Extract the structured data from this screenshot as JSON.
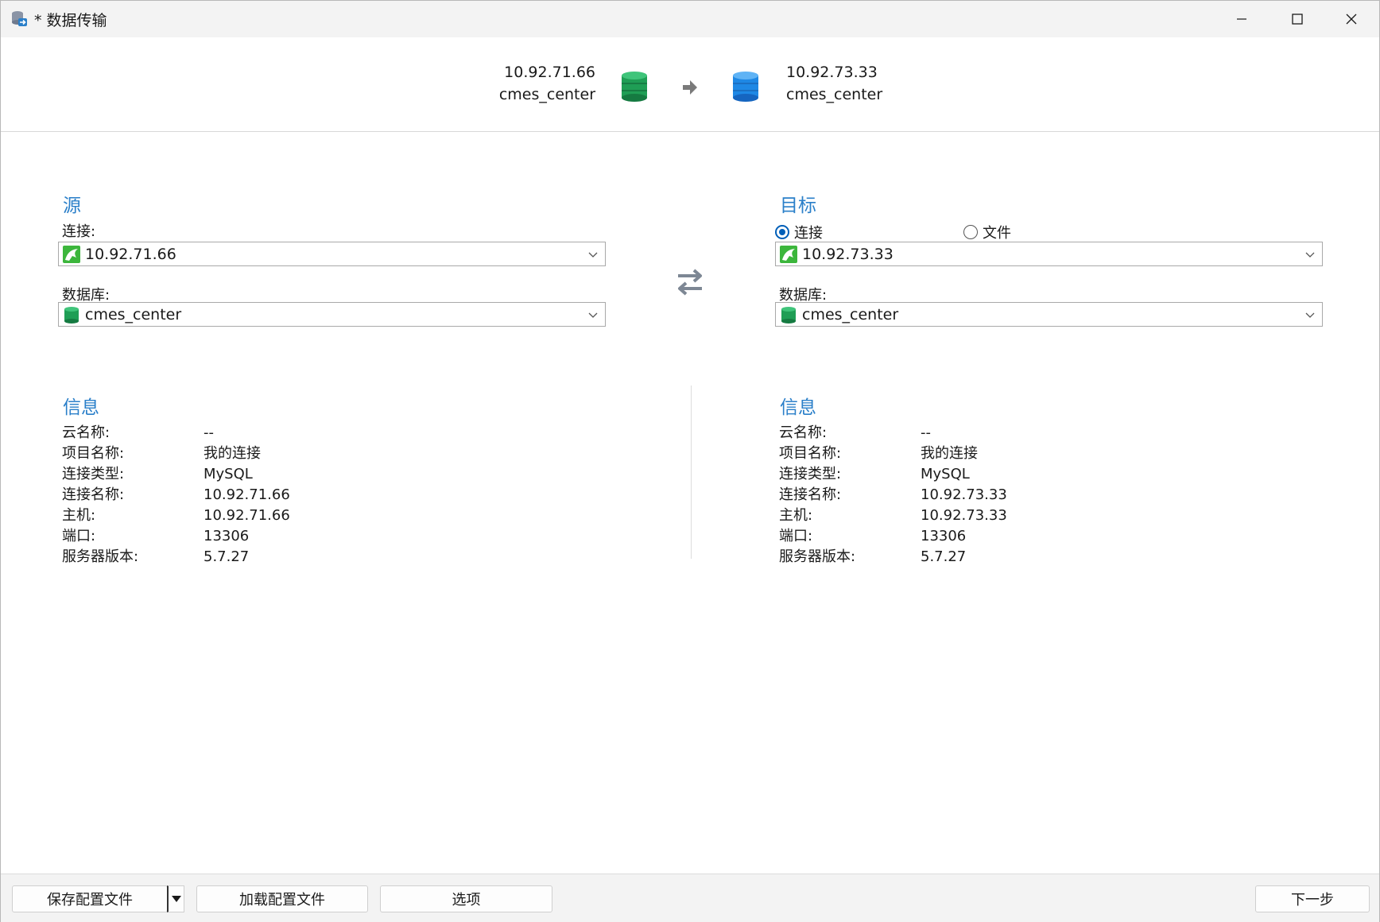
{
  "window": {
    "title": "* 数据传输"
  },
  "header": {
    "source_host": "10.92.71.66",
    "source_db": "cmes_center",
    "target_host": "10.92.73.33",
    "target_db": "cmes_center"
  },
  "source": {
    "title": "源",
    "connection_label": "连接:",
    "connection_value": "10.92.71.66",
    "database_label": "数据库:",
    "database_value": "cmes_center"
  },
  "target": {
    "title": "目标",
    "radio_connection": "连接",
    "radio_file": "文件",
    "connection_value": "10.92.73.33",
    "database_label": "数据库:",
    "database_value": "cmes_center"
  },
  "source_info": {
    "title": "信息",
    "rows": [
      {
        "key": "云名称:",
        "value": "--"
      },
      {
        "key": "项目名称:",
        "value": "我的连接"
      },
      {
        "key": "连接类型:",
        "value": "MySQL"
      },
      {
        "key": "连接名称:",
        "value": "10.92.71.66"
      },
      {
        "key": "主机:",
        "value": "10.92.71.66"
      },
      {
        "key": "端口:",
        "value": "13306"
      },
      {
        "key": "服务器版本:",
        "value": "5.7.27"
      }
    ]
  },
  "target_info": {
    "title": "信息",
    "rows": [
      {
        "key": "云名称:",
        "value": "--"
      },
      {
        "key": "项目名称:",
        "value": "我的连接"
      },
      {
        "key": "连接类型:",
        "value": "MySQL"
      },
      {
        "key": "连接名称:",
        "value": "10.92.73.33"
      },
      {
        "key": "主机:",
        "value": "10.92.73.33"
      },
      {
        "key": "端口:",
        "value": "13306"
      },
      {
        "key": "服务器版本:",
        "value": "5.7.27"
      }
    ]
  },
  "bottom": {
    "save_profile": "保存配置文件",
    "load_profile": "加载配置文件",
    "options": "选项",
    "next": "下一步"
  },
  "colors": {
    "accent": "#2a7fc9",
    "radio_selected": "#005fb8",
    "source_db_green": "#1f9e55",
    "target_db_blue": "#1e88e5"
  },
  "icons": {
    "app": "data-transfer-icon",
    "source_db": "green-database-icon",
    "target_db": "blue-database-icon",
    "transfer_arrow": "arrow-right-icon",
    "swap": "swap-arrows-icon",
    "mysql": "mysql-connection-icon"
  }
}
